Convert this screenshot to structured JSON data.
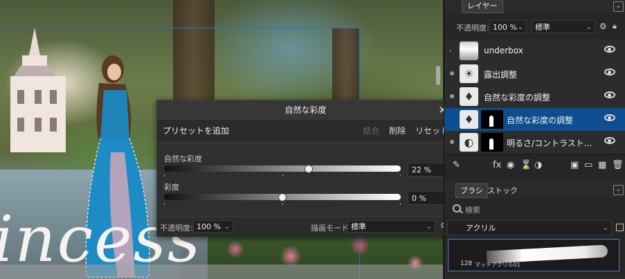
{
  "canvas": {
    "big_text": "incess"
  },
  "dialog": {
    "title": "自然な彩度",
    "close_glyph": "✕",
    "preset_add": "プリセットを追加",
    "merge": "結合",
    "delete": "削除",
    "reset": "リセット",
    "vibrance_label": "自然な彩度",
    "vibrance_value": "22 %",
    "vibrance_level": 0.61,
    "saturation_label": "彩度",
    "saturation_value": "0 %",
    "saturation_level": 0.5,
    "opacity_label": "不透明度:",
    "opacity_value": "100 %",
    "blend_label": "描画モード:",
    "blend_value": "標準"
  },
  "layers_panel": {
    "tab": "レイヤー",
    "opacity_label": "不透明度:",
    "opacity_value": "100 %",
    "mode_value": "標準",
    "layers": [
      {
        "name": "underbox",
        "icon": "image-thumb-icon"
      },
      {
        "name": "露出調整",
        "icon": "exposure-icon"
      },
      {
        "name": "自然な彩度の調整",
        "icon": "vibrance-icon"
      },
      {
        "name": "自然な彩度の調整",
        "icon": "vibrance-icon",
        "selected": true
      },
      {
        "name": "明るさ/コントラスト...",
        "icon": "brightness-contrast-icon"
      }
    ]
  },
  "brush_panel": {
    "tab_brush": "ブラシ",
    "tab_stock": "ストック",
    "search_placeholder": "検索",
    "category": "アクリル",
    "brush_size": "128",
    "brush_name": "マットアクリル01"
  },
  "colors": {
    "accent": "#0e4e8e",
    "guide": "#2b6fd6"
  }
}
